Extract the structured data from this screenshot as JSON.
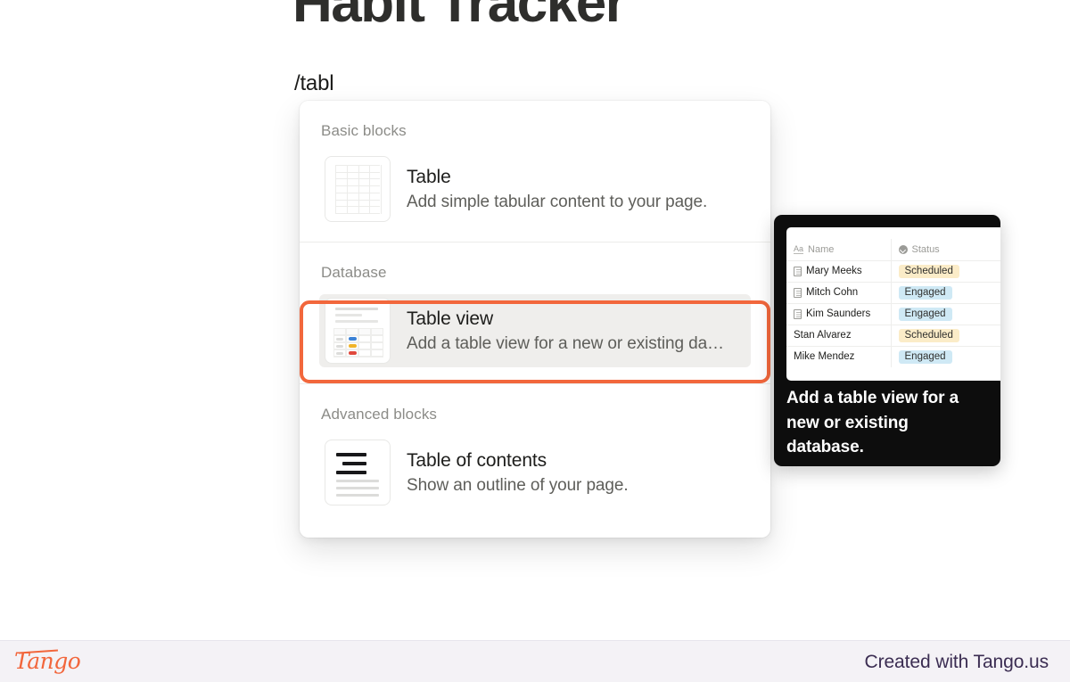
{
  "page": {
    "title": "Habit Tracker",
    "slash_command": "/tabl"
  },
  "menu": {
    "sections": [
      {
        "label": "Basic blocks",
        "items": [
          {
            "title": "Table",
            "description": "Add simple tabular content to your page.",
            "icon": "table-grid-icon",
            "highlighted": false
          }
        ]
      },
      {
        "label": "Database",
        "items": [
          {
            "title": "Table view",
            "description": "Add a table view for a new or existing da…",
            "icon": "table-view-icon",
            "highlighted": true
          }
        ]
      },
      {
        "label": "Advanced blocks",
        "items": [
          {
            "title": "Table of contents",
            "description": "Show an outline of your page.",
            "icon": "table-of-contents-icon",
            "highlighted": false
          }
        ]
      }
    ],
    "highlight_color": "#f2673c"
  },
  "tooltip": {
    "description": "Add a table view for a new or existing database.",
    "background_color": "#0d0d0d",
    "preview": {
      "columns": [
        {
          "label": "Name",
          "icon": "text-property-icon"
        },
        {
          "label": "Status",
          "icon": "select-property-icon"
        }
      ],
      "rows": [
        {
          "name": "Mary Meeks",
          "has_page_icon": true,
          "status": "Scheduled",
          "status_color": "#fbecc8"
        },
        {
          "name": "Mitch Cohn",
          "has_page_icon": true,
          "status": "Engaged",
          "status_color": "#cfe9f5"
        },
        {
          "name": "Kim Saunders",
          "has_page_icon": true,
          "status": "Engaged",
          "status_color": "#cfe9f5"
        },
        {
          "name": "Stan Alvarez",
          "has_page_icon": false,
          "status": "Scheduled",
          "status_color": "#fbecc8"
        },
        {
          "name": "Mike Mendez",
          "has_page_icon": false,
          "status": "Engaged",
          "status_color": "#cfe9f5"
        }
      ]
    }
  },
  "footer": {
    "logo_text": "Tango",
    "credit": "Created with Tango.us",
    "logo_color": "#f2663c",
    "credit_color": "#3b2d52"
  }
}
